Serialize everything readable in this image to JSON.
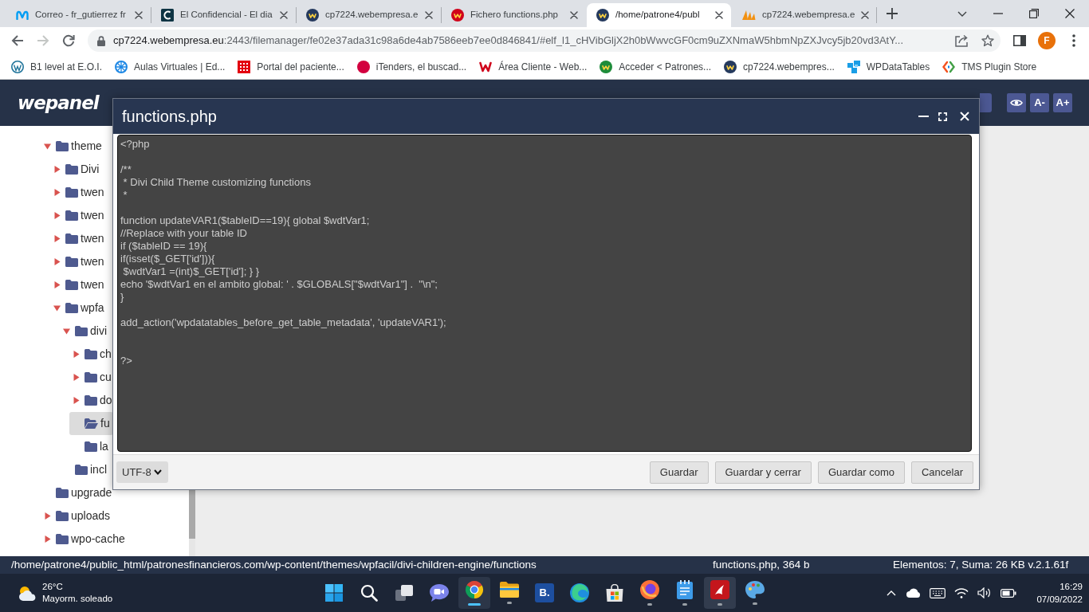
{
  "browser": {
    "tabs": [
      {
        "title": "Correo - fr_gutierrez fr",
        "kind": "wave",
        "color": "#019df4",
        "selected": false
      },
      {
        "title": "El Confidencial - El dia",
        "kind": "tile",
        "color": "#0e3443",
        "selected": false
      },
      {
        "title": "cp7224.webempresa.e",
        "kind": "badge",
        "color": "#253a5e",
        "selected": false
      },
      {
        "title": "Fichero functions.php",
        "kind": "badge",
        "color": "#d0021b",
        "selected": false
      },
      {
        "title": "/home/patrone4/publ",
        "kind": "badge",
        "color": "#253a5e",
        "selected": true
      },
      {
        "title": "cp7224.webempresa.e",
        "kind": "sails",
        "color": "#f29111",
        "selected": false
      }
    ],
    "navigation": {
      "back_enabled": true,
      "forward_enabled": false
    },
    "address": {
      "host": "cp7224.webempresa.eu",
      "path": ":2443/filemanager/fe02e37ada31c98a6de4ab7586eeb7ee0d846841/#elf_l1_cHVibGljX2h0bWwvcGF0cm9uZXNmaW5hbmNpZXJvcy5jb20vd3AtY..."
    },
    "profile_initial": "F",
    "bookmarks": [
      {
        "label": "B1 level at E.O.I.",
        "kind": "ring",
        "color": "#21759b"
      },
      {
        "label": "Aulas Virtuales | Ed...",
        "kind": "wheel",
        "color": "#1e88e5"
      },
      {
        "label": "Portal del paciente...",
        "kind": "grid",
        "color": "#e3000f"
      },
      {
        "label": "iTenders, el buscad...",
        "kind": "dot",
        "color": "#d3003f"
      },
      {
        "label": "Área Cliente - Web...",
        "kind": "zigzag",
        "color": "#d0021b"
      },
      {
        "label": "Acceder < Patrones...",
        "kind": "badge",
        "color": "#1e8c3a"
      },
      {
        "label": "cp7224.webempres...",
        "kind": "badge",
        "color": "#253a5e"
      },
      {
        "label": "WPDataTables",
        "kind": "tiles",
        "color": "#1a9ee6"
      },
      {
        "label": "TMS Plugin Store",
        "kind": "chevrons",
        "color": "#f4511e"
      }
    ]
  },
  "app": {
    "logo": "wepanel",
    "header_buttons": [
      {
        "kind": "partial"
      },
      {
        "kind": "eye"
      },
      {
        "kind": "text",
        "label": "A-"
      },
      {
        "kind": "text",
        "label": "A+"
      }
    ],
    "tree": [
      {
        "label": "theme",
        "kind": "branch",
        "expanded": true,
        "selected": false,
        "children": [
          {
            "label": "Divi",
            "kind": "branch",
            "expanded": false,
            "selected": false
          },
          {
            "label": "twen",
            "kind": "branch",
            "expanded": false,
            "selected": false
          },
          {
            "label": "twen",
            "kind": "branch",
            "expanded": false,
            "selected": false
          },
          {
            "label": "twen",
            "kind": "branch",
            "expanded": false,
            "selected": false
          },
          {
            "label": "twen",
            "kind": "branch",
            "expanded": false,
            "selected": false
          },
          {
            "label": "twen",
            "kind": "branch",
            "expanded": false,
            "selected": false
          },
          {
            "label": "wpfa",
            "kind": "branch",
            "expanded": true,
            "selected": false,
            "children": [
              {
                "label": "divi",
                "kind": "branch",
                "expanded": true,
                "selected": false,
                "children": [
                  {
                    "label": "ch",
                    "kind": "branch",
                    "expanded": false,
                    "selected": false
                  },
                  {
                    "label": "cu",
                    "kind": "branch",
                    "expanded": false,
                    "selected": false
                  },
                  {
                    "label": "do",
                    "kind": "branch",
                    "expanded": false,
                    "selected": false
                  },
                  {
                    "label": "fu",
                    "kind": "leaf",
                    "selected": true
                  },
                  {
                    "label": "la",
                    "kind": "leaf",
                    "selected": false
                  }
                ]
              },
              {
                "label": "incl",
                "kind": "leaf",
                "selected": false
              }
            ]
          }
        ]
      },
      {
        "label": "upgrade",
        "kind": "leaf",
        "selected": false
      },
      {
        "label": "uploads",
        "kind": "branch",
        "expanded": false,
        "selected": false
      },
      {
        "label": "wpo-cache",
        "kind": "branch",
        "expanded": false,
        "selected": false
      }
    ]
  },
  "dialog": {
    "title": "functions.php",
    "code": "<?php\n\n/**\n * Divi Child Theme customizing functions\n *\n\nfunction updateVAR1($tableID==19){ global $wdtVar1;\n//Replace with your table ID\nif ($tableID == 19){\nif(isset($_GET['id'])){\n $wdtVar1 =(int)$_GET['id']; } }\necho '$wdtVar1 en el ambito global: ' . $GLOBALS[\"$wdtVar1\"] .  \"\\n\";\n}\n\nadd_action('wpdatatables_before_get_table_metadata', 'updateVAR1');\n\n\n?>",
    "encoding": "UTF-8",
    "buttons": [
      "Guardar",
      "Guardar y cerrar",
      "Guardar como",
      "Cancelar"
    ]
  },
  "status_bar": {
    "path": "/home/patrone4/public_html/patronesfinancieros.com/wp-content/themes/wpfacil/divi-children-engine/functions",
    "file_info": "functions.php, 364 b",
    "summary": "Elementos: 7, Suma: 26 KB v.2.1.61f"
  },
  "taskbar": {
    "weather": {
      "temperature": "26°C",
      "condition": "Mayorm. soleado"
    },
    "apps": [
      {
        "kind": "start",
        "running": false,
        "selected": false,
        "highlighted": false
      },
      {
        "kind": "search",
        "running": false,
        "selected": false,
        "highlighted": false
      },
      {
        "kind": "taskview",
        "running": false,
        "selected": false,
        "highlighted": false
      },
      {
        "kind": "chat",
        "running": false,
        "selected": false,
        "highlighted": false
      },
      {
        "kind": "chrome",
        "running": true,
        "selected": true,
        "highlighted": false
      },
      {
        "kind": "folder",
        "running": true,
        "selected": false,
        "highlighted": false
      },
      {
        "kind": "letter",
        "label": "B.",
        "running": false,
        "selected": false,
        "highlighted": false
      },
      {
        "kind": "swirl",
        "running": false,
        "selected": false,
        "highlighted": false
      },
      {
        "kind": "store",
        "running": false,
        "selected": false,
        "highlighted": false
      },
      {
        "kind": "globe",
        "running": true,
        "selected": false,
        "highlighted": false
      },
      {
        "kind": "notepad",
        "running": true,
        "selected": false,
        "highlighted": false
      },
      {
        "kind": "reader",
        "running": true,
        "selected": false,
        "highlighted": true
      },
      {
        "kind": "palette",
        "running": true,
        "selected": false,
        "highlighted": false
      }
    ],
    "clock": {
      "time": "16:29",
      "date": "07/09/2022"
    }
  }
}
